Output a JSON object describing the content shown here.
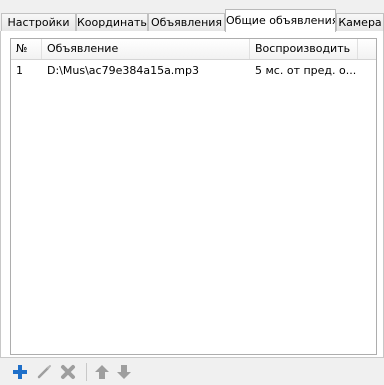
{
  "tabs": [
    {
      "label": "Настройки",
      "active": false
    },
    {
      "label": "Координаты",
      "active": false
    },
    {
      "label": "Объявления",
      "active": false
    },
    {
      "label": "Общие объявления",
      "active": true
    },
    {
      "label": "Камера",
      "active": false
    }
  ],
  "table": {
    "columns": [
      "№",
      "Объявление",
      "Воспроизводить"
    ],
    "rows": [
      {
        "num": "1",
        "file": "D:\\Mus\\ac79e384a15a.mp3",
        "play": "5 мс. от пред. о..."
      }
    ]
  },
  "toolbar": {
    "icons": [
      "add-icon",
      "edit-icon",
      "delete-icon",
      "move-up-icon",
      "move-down-icon"
    ],
    "colors": {
      "add": "#1e6fc9",
      "disabled": "#9e9e9e"
    }
  }
}
